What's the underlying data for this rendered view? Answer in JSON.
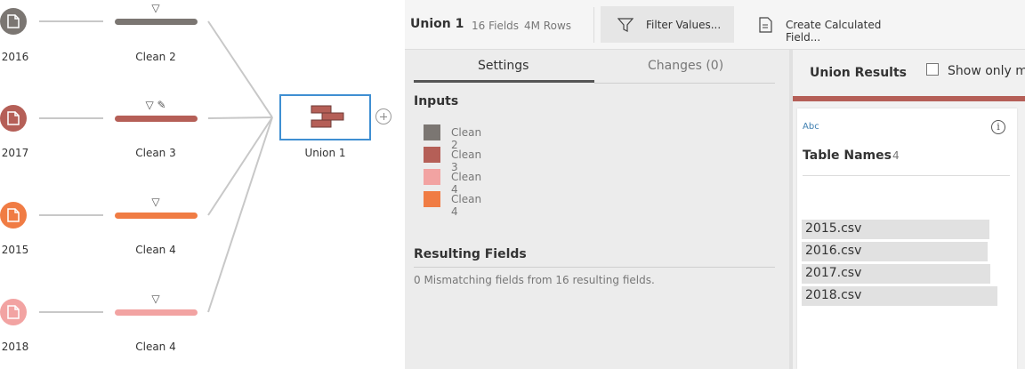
{
  "flow": {
    "sources": [
      {
        "year": "2016",
        "color": "#7b7672",
        "icon": "file-icon"
      },
      {
        "year": "2017",
        "color": "#b55f57",
        "icon": "file-icon"
      },
      {
        "year": "2015",
        "color": "#f07c44",
        "icon": "file-icon"
      },
      {
        "year": "2018",
        "color": "#f2a3a2",
        "icon": "file-icon"
      }
    ],
    "cleans": [
      {
        "label": "Clean 2",
        "color": "#7b7672",
        "icons": "▽"
      },
      {
        "label": "Clean 3",
        "color": "#b55f57",
        "icons": "▽ ✎"
      },
      {
        "label": "Clean 4",
        "color": "#f07c44",
        "icons": "▽"
      },
      {
        "label": "Clean 4",
        "color": "#f2a3a2",
        "icons": "▽"
      }
    ],
    "union": {
      "label": "Union 1",
      "color": "#b55f57",
      "add_icon": "plus-circle-icon"
    }
  },
  "toolbar": {
    "step_name": "Union 1",
    "fields": "16 Fields",
    "rows": "4M Rows",
    "filter_label": "Filter Values...",
    "filter_icon": "funnel-icon",
    "calc_label": "Create Calculated Field...",
    "calc_icon": "calculated-field-icon"
  },
  "settings": {
    "tabs": {
      "settings": "Settings",
      "changes": "Changes (0)"
    },
    "inputs_title": "Inputs",
    "inputs": [
      {
        "label": "Clean 2",
        "color": "#7b7672"
      },
      {
        "label": "Clean 3",
        "color": "#b55f57"
      },
      {
        "label": "Clean 4",
        "color": "#f2a3a2"
      },
      {
        "label": "Clean 4",
        "color": "#f07c44"
      }
    ],
    "resulting_title": "Resulting Fields",
    "resulting_text": "0 Mismatching fields from 16 resulting fields."
  },
  "results": {
    "title": "Union Results",
    "show_only": "Show only m",
    "card": {
      "type": "Abc",
      "field_name": "Table Names",
      "count": "4",
      "values": [
        "2015.csv",
        "2016.csv",
        "2017.csv",
        "2018.csv"
      ]
    }
  }
}
